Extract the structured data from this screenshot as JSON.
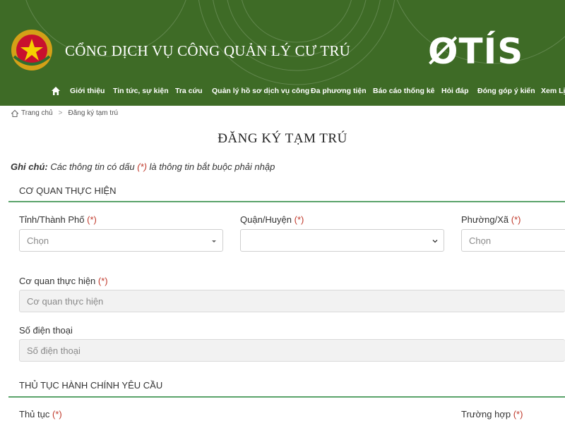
{
  "header": {
    "site_title": "CỔNG DỊCH VỤ CÔNG QUẢN LÝ CƯ TRÚ",
    "brand_logo_text": "ØTÍS",
    "bg_color": "#3e6b26"
  },
  "nav": {
    "home_icon": "home-icon",
    "items": [
      "Giới thiệu",
      "Tin tức, sự kiện",
      "Tra cứu",
      "Quản lý hồ sơ dịch vụ công",
      "Đa phương tiện",
      "Báo cáo thống kê",
      "Hỏi đáp",
      "Đóng góp ý kiến",
      "Xem Lị"
    ]
  },
  "breadcrumb": {
    "home": "Trang chủ",
    "separator": ">",
    "current": "Đăng ký tạm trú"
  },
  "page_title": "ĐĂNG KÝ TẠM TRÚ",
  "note": {
    "label": "Ghi chú:",
    "text_before": " Các thông tin có dấu ",
    "required_mark": "(*)",
    "text_after": " là thông tin bắt buộc phải nhập"
  },
  "section1": {
    "title": "CƠ QUAN THỰC HIỆN",
    "province_label": "Tỉnh/Thành Phố",
    "province_value": "Chọn",
    "district_label": "Quận/Huyện",
    "district_value": "",
    "ward_label": "Phường/Xã",
    "ward_value": "Chọn",
    "agency_label": "Cơ quan thực hiện",
    "agency_placeholder": "Cơ quan thực hiện",
    "phone_label": "Số điện thoại",
    "phone_placeholder": "Số điện thoại"
  },
  "section2": {
    "title": "THỦ TỤC HÀNH CHÍNH YÊU CẦU",
    "procedure_label": "Thủ tục",
    "case_label": "Trường hợp"
  },
  "required_mark": "(*)",
  "accent_color": "#5aa36a",
  "required_color": "#c0392b"
}
